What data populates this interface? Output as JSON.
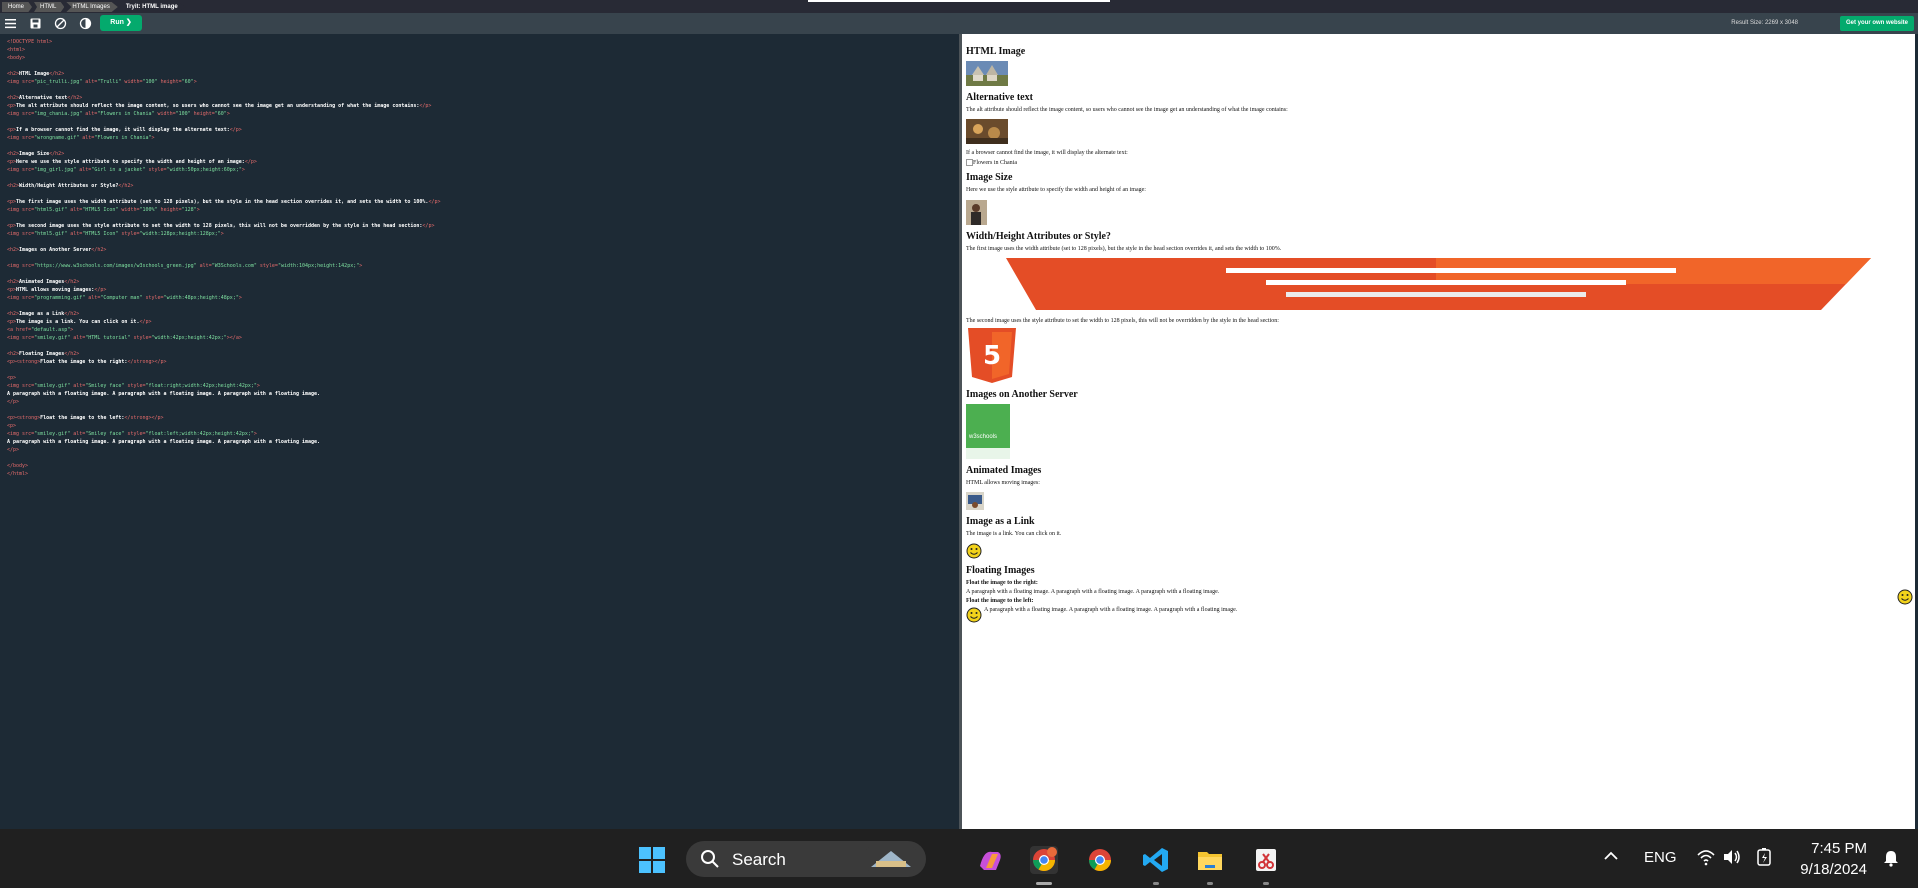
{
  "breadcrumb": [
    "Home",
    "HTML",
    "HTML Images",
    "Tryit: HTML image"
  ],
  "toolbar": {
    "run_label": "Run ❯",
    "result_size": "Result Size: 2269 x 3048",
    "own_site_label": "Get your own website"
  },
  "code_lines": [
    "<!DOCTYPE html>",
    "<html>",
    "<body>",
    "",
    "<h2>HTML Image</h2>",
    "<img src=\"pic_trulli.jpg\" alt=\"Trulli\" width=\"100\" height=\"60\">",
    "",
    "<h2>Alternative text</h2>",
    "<p>The alt attribute should reflect the image content, so users who cannot see the image get an understanding of what the image contains:</p>",
    "<img src=\"img_chania.jpg\" alt=\"Flowers in Chania\" width=\"100\" height=\"60\">",
    "",
    "<p>If a browser cannot find the image, it will display the alternate text:</p>",
    "<img src=\"wrongname.gif\" alt=\"Flowers in Chania\">",
    "",
    "<h2>Image Size</h2>",
    "<p>Here we use the style attribute to specify the width and height of an image:</p>",
    "<img src=\"img_girl.jpg\" alt=\"Girl in a jacket\" style=\"width:50px;height:60px;\">",
    "",
    "<h2>Width/Height Attributes or Style?</h2>",
    "",
    "<p>The first image uses the width attribute (set to 128 pixels), but the style in the head section overrides it, and sets the width to 100%.</p>",
    "<img src=\"html5.gif\" alt=\"HTML5 Icon\" width=\"100%\" height=\"128\">",
    "",
    "<p>The second image uses the style attribute to set the width to 128 pixels, this will not be overridden by the style in the head section:</p>",
    "<img src=\"html5.gif\" alt=\"HTML5 Icon\" style=\"width:128px;height:128px;\">",
    "",
    "<h2>Images on Another Server</h2>",
    "",
    "<img src=\"https://www.w3schools.com/images/w3schools_green.jpg\" alt=\"W3Schools.com\" style=\"width:104px;height:142px;\">",
    "",
    "<h2>Animated Images</h2>",
    "<p>HTML allows moving images:</p>",
    "<img src=\"programming.gif\" alt=\"Computer man\" style=\"width:48px;height:48px;\">",
    "",
    "<h2>Image as a Link</h2>",
    "<p>The image is a link. You can click on it.</p>",
    "<a href=\"default.asp\">",
    "<img src=\"smiley.gif\" alt=\"HTML tutorial\" style=\"width:42px;height:42px;\"></a>",
    "",
    "<h2>Floating Images</h2>",
    "<p><strong>Float the image to the right:</strong></p>",
    "",
    "<p>",
    "<img src=\"smiley.gif\" alt=\"Smiley face\" style=\"float:right;width:42px;height:42px;\">",
    "A paragraph with a floating image. A paragraph with a floating image. A paragraph with a floating image.",
    "</p>",
    "",
    "<p><strong>Float the image to the left:</strong></p>",
    "<p>",
    "<img src=\"smiley.gif\" alt=\"Smiley face\" style=\"float:left;width:42px;height:42px;\">",
    "A paragraph with a floating image. A paragraph with a floating image. A paragraph with a floating image.",
    "</p>",
    "",
    "</body>",
    "</html>"
  ],
  "result": {
    "h_html_image": "HTML Image",
    "h_alt": "Alternative text",
    "p_alt": "The alt attribute should reflect the image content, so users who cannot see the image get an understanding of what the image contains:",
    "p_broken": "If a browser cannot find the image, it will display the alternate text:",
    "broken_alt": "Flowers in Chania",
    "h_size": "Image Size",
    "p_size": "Here we use the style attribute to specify the width and height of an image:",
    "h_wh": "Width/Height Attributes or Style?",
    "p_wh1": "The first image uses the width attribute (set to 128 pixels), but the style in the head section overrides it, and sets the width to 100%.",
    "p_wh2": "The second image uses the style attribute to set the width to 128 pixels, this will not be overridden by the style in the head section:",
    "h_server": "Images on Another Server",
    "w3_logo_text": "w3schools",
    "h_anim": "Animated Images",
    "p_anim": "HTML allows moving images:",
    "h_link": "Image as a Link",
    "p_link": "The image is a link. You can click on it.",
    "h_float": "Floating Images",
    "float_right_label": "Float the image to the right:",
    "float_para": "A paragraph with a floating image. A paragraph with a floating image. A paragraph with a floating image.",
    "float_left_label": "Float the image to the left:"
  },
  "taskbar": {
    "search_label": "Search",
    "lang": "ENG",
    "time": "7:45 PM",
    "date": "9/18/2024"
  },
  "colors": {
    "run_green": "#04aa6d",
    "editor_bg": "#1d2a35",
    "taskbar_bg": "#202020",
    "html5_orange": "#e44d26"
  }
}
